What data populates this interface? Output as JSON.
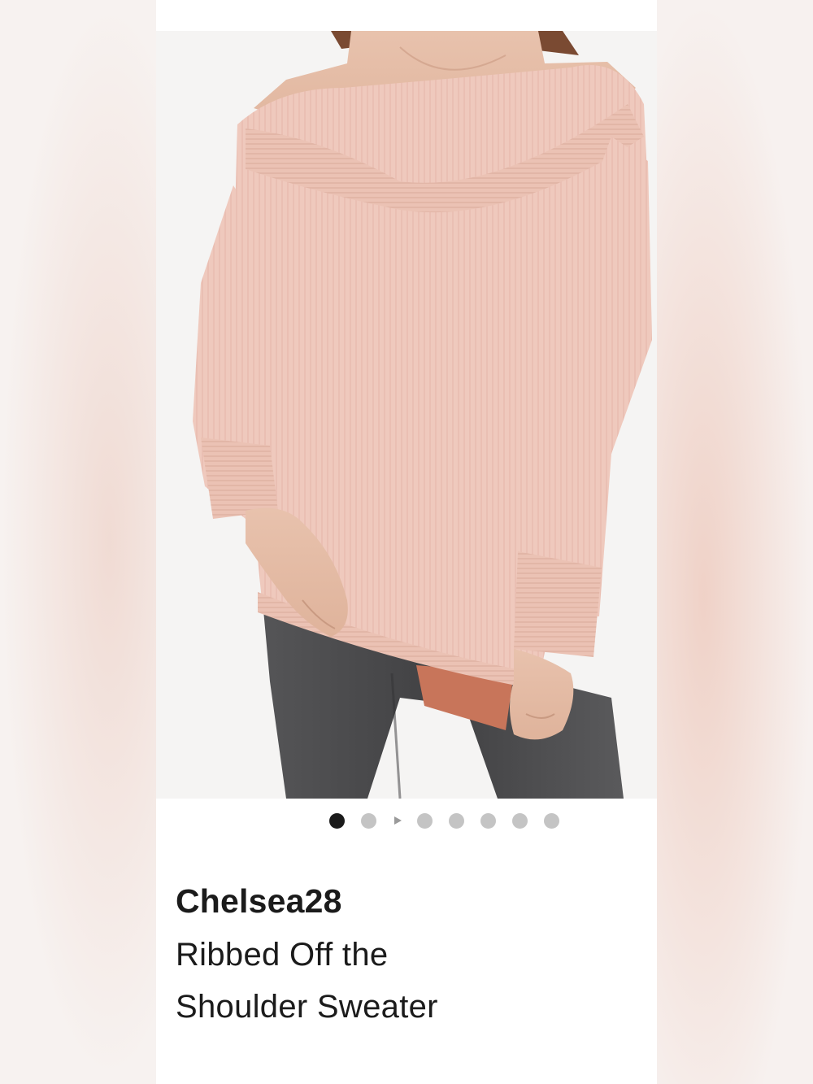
{
  "product": {
    "brand": "Chelsea28",
    "name": "Ribbed Off the Shoulder Sweater",
    "image_description_icon": "product-photo"
  },
  "carousel": {
    "total_items": 8,
    "active_index": 0,
    "video_indicator_after_index": 1
  },
  "colors": {
    "sweater": "#efc9bd",
    "jeans": "#4a4a4c",
    "background_card": "#ffffff",
    "dot_active": "#1a1a1a",
    "dot_inactive": "#c4c4c4"
  }
}
